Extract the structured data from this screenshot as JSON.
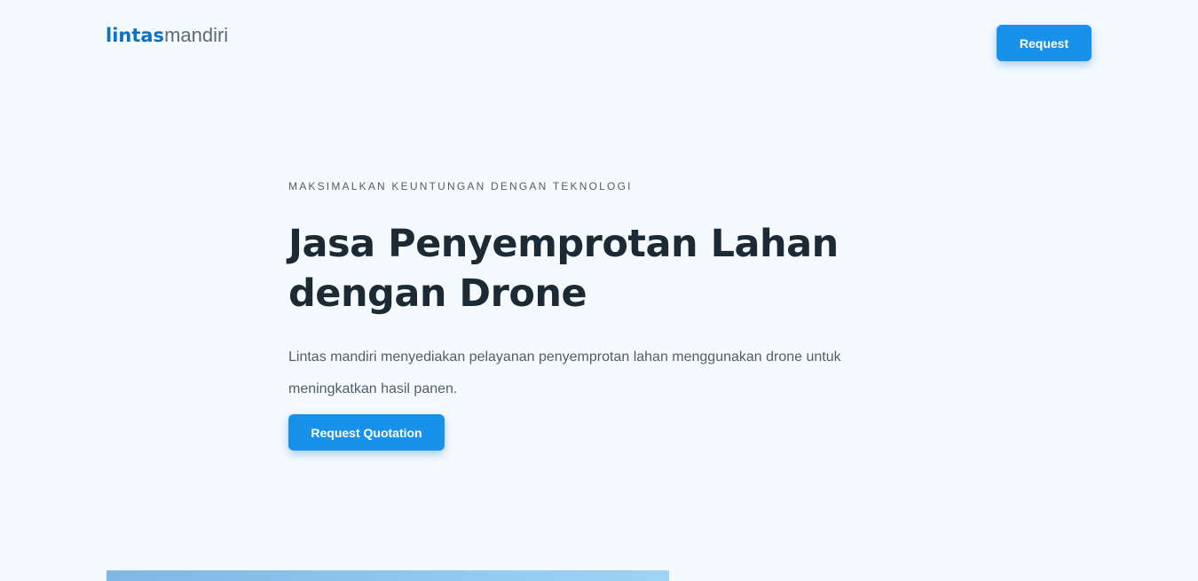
{
  "header": {
    "logo_bold": "lintas",
    "logo_light": "mandiri",
    "request_button_label": "Request"
  },
  "hero": {
    "eyebrow": "MAKSIMALKAN KEUNTUNGAN DENGAN TEKNOLOGI",
    "title": "Jasa Penyemprotan Lahan dengan Drone",
    "description": "Lintas mandiri menyediakan pelayanan penyemprotan lahan menggunakan drone untuk meningkatkan hasil panen.",
    "cta_label": "Request Quotation"
  },
  "colors": {
    "background": "#f5faff",
    "accent": "#1791ea",
    "brand": "#0b73c6",
    "heading": "#1c2a36",
    "body_text": "#4f5e6b"
  }
}
